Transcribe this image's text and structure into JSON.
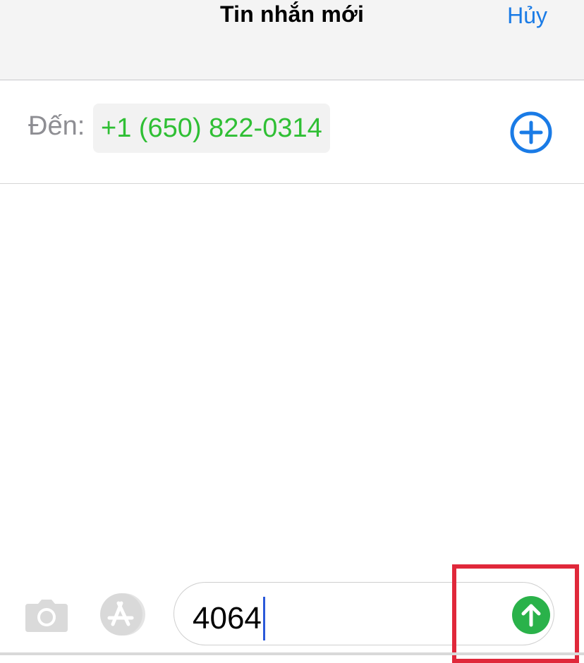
{
  "header": {
    "title": "Tin nhắn mới",
    "cancel_label": "Hủy"
  },
  "recipient": {
    "to_label": "Đến:",
    "phone": "+1 (650) 822-0314"
  },
  "compose": {
    "text": "4064"
  },
  "icons": {
    "add_contact": "plus-circle-icon",
    "camera": "camera-icon",
    "app_store": "app-store-icon",
    "send": "arrow-up-circle-icon"
  },
  "colors": {
    "accent_blue": "#1a7be6",
    "recipient_green": "#2fbf34",
    "send_green": "#2ab24a",
    "highlight_red": "#e0283a",
    "caret_blue": "#2b59d9"
  }
}
